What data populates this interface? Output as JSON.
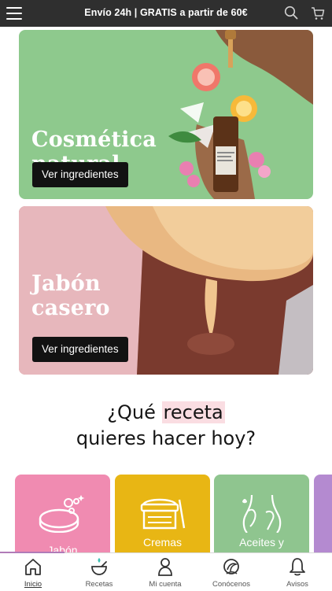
{
  "topbar": {
    "shipping_text": "Envío 24h | GRATIS a partir de 60€"
  },
  "cards": [
    {
      "title_line1": "Cosmética",
      "title_line2": "natural",
      "button": "Ver ingredientes",
      "color": "#8ec98d"
    },
    {
      "title_line1": "Jabón",
      "title_line2": "casero",
      "button": "Ver ingredientes",
      "color": "#e6a7ad"
    }
  ],
  "question": {
    "prefix": "¿Qué ",
    "highlight": "receta",
    "line2": "quieres hacer hoy?"
  },
  "categories": [
    {
      "label": "Jabón",
      "color": "#f08bb1",
      "icon": "soap-icon"
    },
    {
      "label": "Cremas",
      "color": "#e8b614",
      "icon": "cream-jar-icon"
    },
    {
      "label": "Aceites y",
      "color": "#8fc58f",
      "icon": "body-oil-icon"
    },
    {
      "label": "",
      "color": "#b48ad0",
      "icon": ""
    }
  ],
  "tabs": [
    {
      "label": "Inicio",
      "icon": "home-icon",
      "active": true
    },
    {
      "label": "Recetas",
      "icon": "recipes-bowl-icon",
      "active": false
    },
    {
      "label": "Mi cuenta",
      "icon": "user-icon",
      "active": false
    },
    {
      "label": "Conócenos",
      "icon": "about-icon",
      "active": false
    },
    {
      "label": "Avisos",
      "icon": "bell-icon",
      "active": false
    }
  ],
  "colors": {
    "accent": "#b07bb8",
    "highlight": "#fadde2",
    "topbar": "#2f2f2f"
  }
}
